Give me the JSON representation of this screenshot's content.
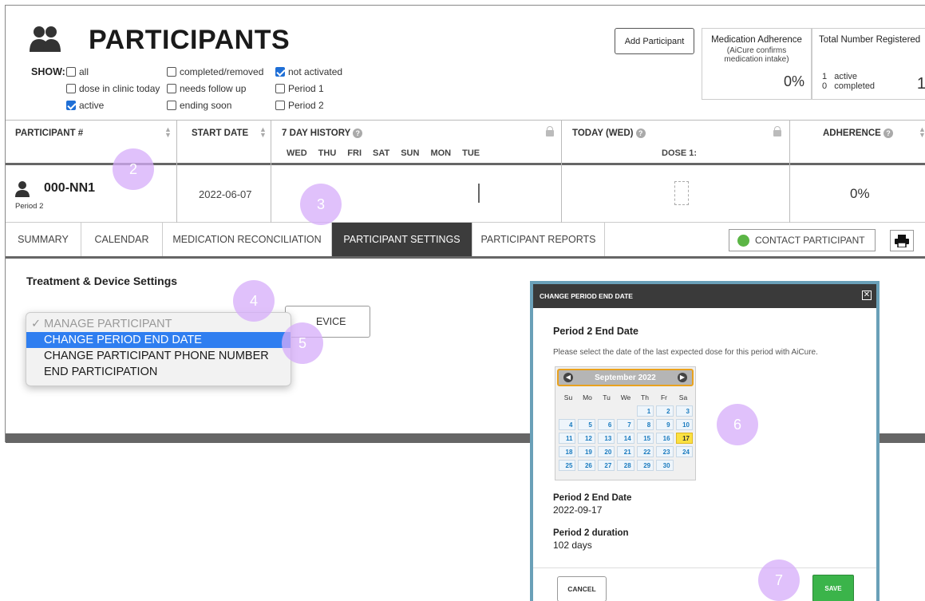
{
  "header": {
    "title": "PARTICIPANTS",
    "icon": "participants-icon",
    "show_label": "SHOW:",
    "add_button": "Add Participant"
  },
  "filters": [
    {
      "label": "all",
      "checked": false
    },
    {
      "label": "dose in clinic today",
      "checked": false
    },
    {
      "label": "active",
      "checked": true
    },
    {
      "label": "completed/removed",
      "checked": false
    },
    {
      "label": "needs follow up",
      "checked": false
    },
    {
      "label": "ending soon",
      "checked": false
    },
    {
      "label": "not activated",
      "checked": true
    },
    {
      "label": "Period 1",
      "checked": false
    },
    {
      "label": "Period 2",
      "checked": false
    }
  ],
  "adherence_box": {
    "title": "Medication Adherence",
    "sub1": "(AiCure confirms",
    "sub2": "medication intake)",
    "value": "0%"
  },
  "registered_box": {
    "title": "Total Number Registered",
    "active_count": "1",
    "active_label": "active",
    "completed_count": "0",
    "completed_label": "completed",
    "total": "1"
  },
  "table": {
    "col_participant": "PARTICIPANT #",
    "col_start": "START DATE",
    "col_history": "7 DAY HISTORY",
    "col_today": "TODAY (WED)",
    "col_dose": "DOSE 1:",
    "col_adherence": "ADHERENCE",
    "days": [
      "WED",
      "THU",
      "FRI",
      "SAT",
      "SUN",
      "MON",
      "TUE"
    ]
  },
  "participant": {
    "id": "000-NN1",
    "period": "Period 2",
    "start_date": "2022-06-07",
    "adherence": "0%"
  },
  "tabs": [
    {
      "label": "SUMMARY",
      "active": false
    },
    {
      "label": "CALENDAR",
      "active": false
    },
    {
      "label": "MEDICATION RECONCILIATION",
      "active": false
    },
    {
      "label": "PARTICIPANT SETTINGS",
      "active": true
    },
    {
      "label": "PARTICIPANT REPORTS",
      "active": false
    }
  ],
  "contact_button": "CONTACT PARTICIPANT",
  "section_title": "Treatment & Device Settings",
  "device_button": "EVICE",
  "dropdown": {
    "header": "✓ MANAGE PARTICIPANT",
    "items": [
      "CHANGE PERIOD END DATE",
      "CHANGE PARTICIPANT PHONE NUMBER",
      "END PARTICIPATION"
    ],
    "selected_index": 0
  },
  "modal": {
    "title": "CHANGE PERIOD END DATE",
    "heading": "Period 2 End Date",
    "instructions": "Please select the date of the last expected dose for this period with AiCure.",
    "calendar": {
      "month": "September 2022",
      "dow": [
        "Su",
        "Mo",
        "Tu",
        "We",
        "Th",
        "Fr",
        "Sa"
      ],
      "first_weekday": 4,
      "days_in_month": 30,
      "selected_day": 17
    },
    "end_date_label": "Period 2 End Date",
    "end_date_value": "2022-09-17",
    "duration_label": "Period 2 duration",
    "duration_value": "102 days",
    "cancel": "CANCEL",
    "save": "SAVE"
  },
  "steps": [
    "2",
    "3",
    "4",
    "5",
    "6",
    "7"
  ],
  "colors": {
    "accent_blue": "#2f7ef0",
    "save_green": "#3bb44a",
    "step_purple": "#d6acfa",
    "today_yellow": "#fbe141",
    "dark_tab": "#3c3c3c"
  }
}
